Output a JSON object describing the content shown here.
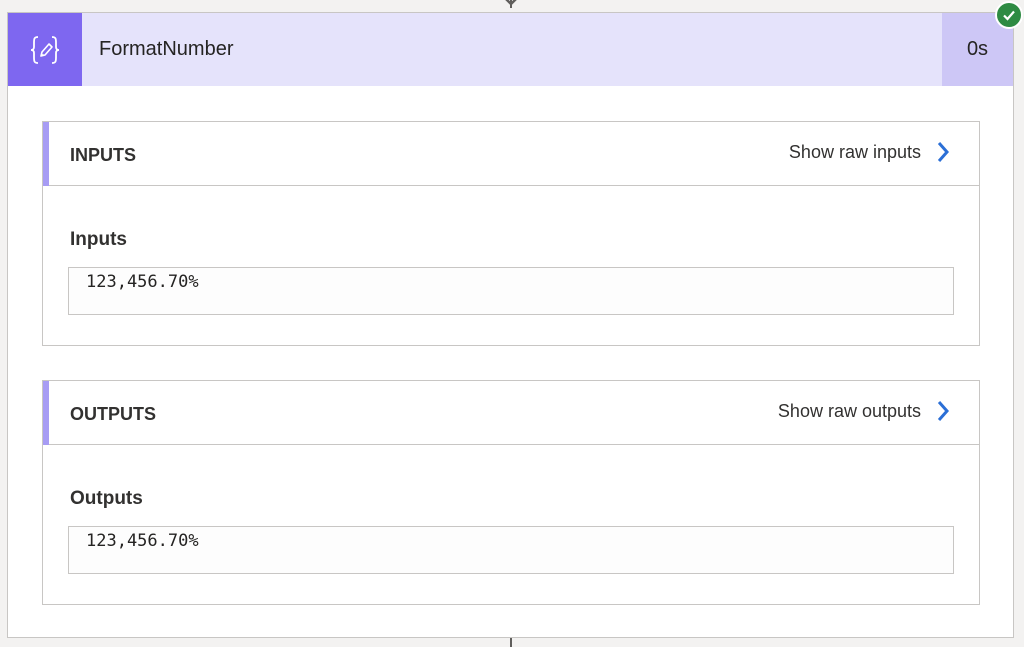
{
  "action": {
    "title": "FormatNumber",
    "duration": "0s",
    "icon": "variable-braces-pencil-icon",
    "status_icon": "checkmark-icon",
    "status_color": "#2e8b43",
    "accent_color": "#7e67f0"
  },
  "inputs": {
    "section_title": "INPUTS",
    "raw_link_label": "Show raw inputs",
    "field_label": "Inputs",
    "value": "123,456.70%"
  },
  "outputs": {
    "section_title": "OUTPUTS",
    "raw_link_label": "Show raw outputs",
    "field_label": "Outputs",
    "value": "123,456.70%"
  }
}
